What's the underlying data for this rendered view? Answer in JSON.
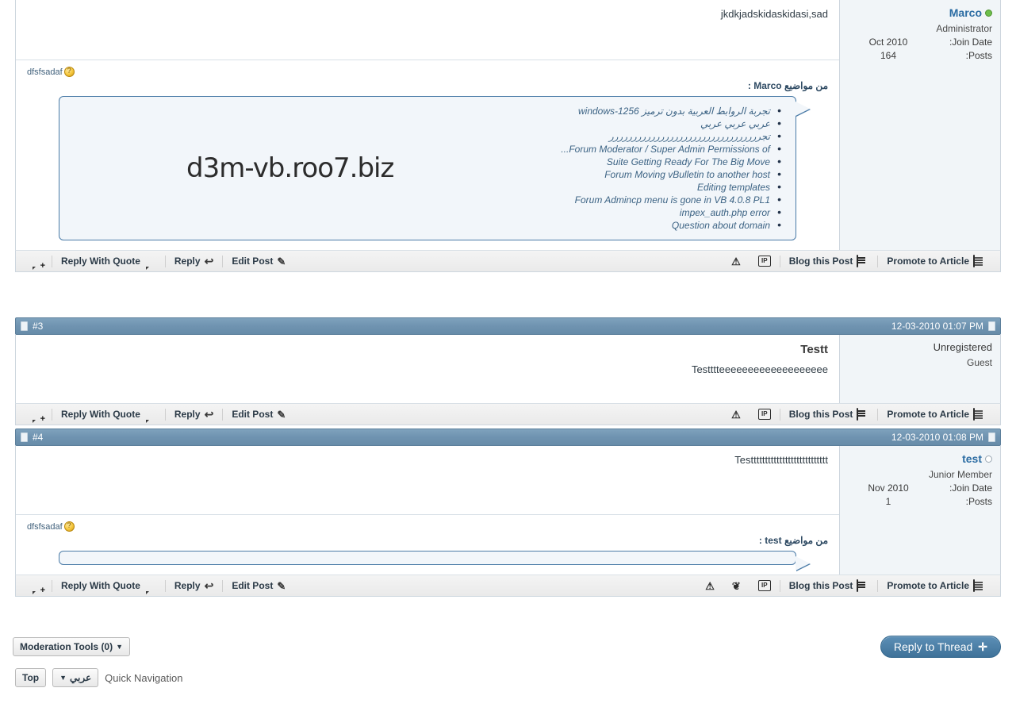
{
  "posts": [
    {
      "id": "post-1-partial",
      "number": "",
      "timestamp": "",
      "author": {
        "name": "Marco",
        "online": true,
        "title": "Administrator",
        "join_label": "Join Date:",
        "join_value": "Oct 2010",
        "posts_label": "Posts:",
        "posts_value": "164"
      },
      "message": "jkdkjadskidaskidasi,sad",
      "signature": {
        "user": "dfsfsadaf",
        "title": "من مواضيع Marco :",
        "watermark": "d3m-vb.roo7.biz",
        "links": [
          "تجربة الروابط العربية بدون ترميز windows-1256",
          "عربي عربي عربي",
          "تجررررررررررررررررررررررررررررررررر",
          "Forum Moderator / Super Admin Permissions of...",
          "Suite Getting Ready For The Big Move",
          "Forum Moving vBulletin to another host",
          "Editing templates",
          "Forum Admincp menu is gone in VB 4.0.8 PL1",
          "impex_auth.php error",
          "Question about domain"
        ]
      }
    },
    {
      "id": "post-3",
      "number": "#3",
      "timestamp": "12-03-2010 01:07 PM",
      "author": {
        "name": "Unregistered",
        "online": false,
        "title": "Guest",
        "join_label": "",
        "join_value": "",
        "posts_label": "",
        "posts_value": ""
      },
      "title_line": "Testt",
      "message": "Testttteeeeeeeeeeeeeeeeeee",
      "signature": null
    },
    {
      "id": "post-4",
      "number": "#4",
      "timestamp": "12-03-2010 01:08 PM",
      "author": {
        "name": "test",
        "online": false,
        "title": "Junior Member",
        "join_label": "Join Date:",
        "join_value": "Nov 2010",
        "posts_label": "Posts:",
        "posts_value": "1"
      },
      "message": "Testtttttttttttttttttttttttttt",
      "signature": {
        "user": "dfsfsadaf",
        "title": "من مواضيع test :",
        "watermark": "",
        "links": []
      }
    }
  ],
  "toolbar": {
    "quick_reply_label": "",
    "reply_with_quote": "Reply With Quote",
    "reply": "Reply",
    "edit_post": "Edit Post",
    "blog_this_post": "Blog this Post",
    "promote_to_article": "Promote to Article",
    "ip_label": "IP"
  },
  "footer": {
    "moderation_tools": "Moderation Tools (0)",
    "top": "Top",
    "forum_select": "عربي",
    "quick_navigation": "Quick Navigation",
    "reply_to_thread": "Reply to Thread"
  },
  "colors": {
    "header_blue": "#6f93b0",
    "link_blue": "#2b6ca3",
    "button_blue": "#4a7ea8",
    "quote_border": "#4a7ba7",
    "quote_bg": "#f2f6fa",
    "side_bg": "#f1f5f8",
    "toolbar_bg": "#eeeeee"
  }
}
